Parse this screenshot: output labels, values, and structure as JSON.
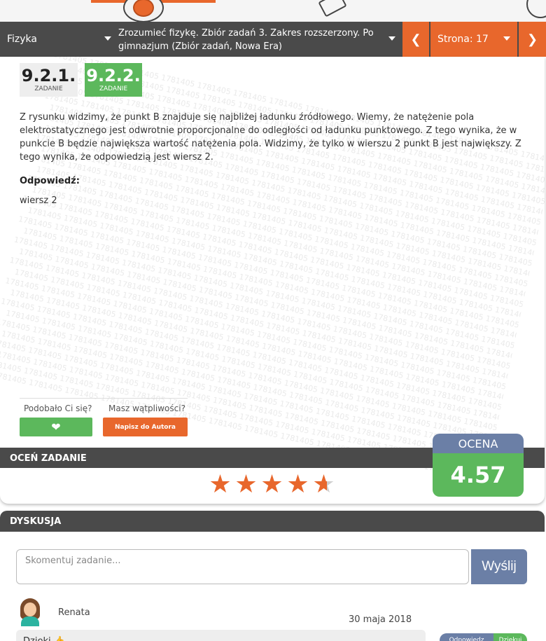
{
  "nav": {
    "subject": "Fizyka",
    "book": "Zrozumieć fizykę. Zbiór zadań 3. Zakres rozszerzony. Po gimnazjum (Zbiór zadań, Nowa Era)",
    "page": "Strona: 17"
  },
  "tasks": [
    {
      "number": "9.2.1.",
      "label": "ZADANIE",
      "active": false
    },
    {
      "number": "9.2.2.",
      "label": "ZADANIE",
      "active": true
    }
  ],
  "solution": {
    "text": "Z rysunku widzimy, że punkt B znajduje się najbliżej ładunku źródłowego. Wiemy, że natężenie pola elektrostatycznego jest odwrotnie proporcjonalne do odległości od ładunku punktowego. Z tego wynika, że w punkcie B będzie największa wartość natężenia pola. Widzimy, że tylko w wierszu 2 punkt B jest największy. Z tego wynika, że odpowiedzią jest wiersz 2.",
    "answer_heading": "Odpowiedź:",
    "answer": "wiersz 2",
    "watermark": "1781405"
  },
  "feedback": {
    "liked_question": "Podobało Ci się?",
    "doubts_question": "Masz wątpliwości?",
    "write_author": "Napisz do Autora"
  },
  "rating": {
    "heading": "OCEŃ ZADANIE",
    "stars": 4.57,
    "max_stars": 5,
    "score_label": "OCENA",
    "score": "4.57"
  },
  "discussion": {
    "heading": "DYSKUSJA",
    "placeholder": "Skomentuj zadanie...",
    "send": "Wyślij",
    "comment": {
      "author": "Renata",
      "date": "30 maja 2018",
      "text": "Dzięki 👍",
      "reply_a": "Odpowiedz",
      "reply_b": "Dziękuj"
    }
  },
  "colors": {
    "accent": "#e8672c",
    "green": "#5cb85c",
    "dark": "#4a4a4a",
    "slate": "#6b7fa6"
  }
}
